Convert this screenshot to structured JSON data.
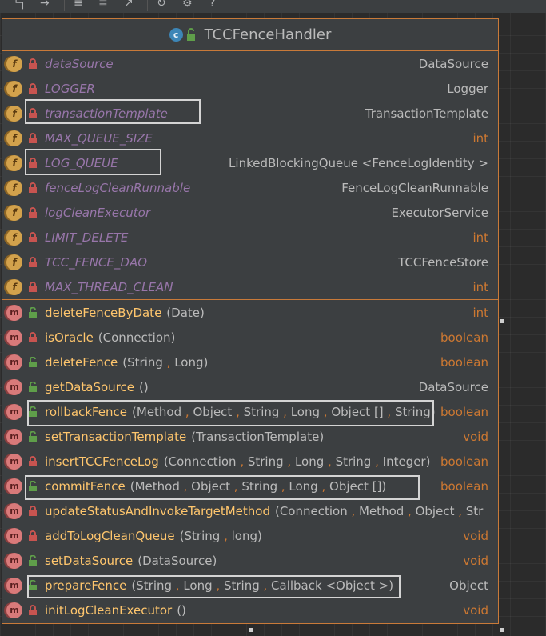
{
  "toolbar": {
    "icons": [
      "layout-icon",
      "arrow-icon",
      "list-icon",
      "filter-icon",
      "export-icon",
      "refresh-icon",
      "gear-icon",
      "help-icon"
    ],
    "help_label": "?"
  },
  "node": {
    "class_badge": "c",
    "title": "TCCFenceHandler",
    "fields": [
      {
        "name": "dataSource",
        "type": "DataSource",
        "keyword": false
      },
      {
        "name": "LOGGER",
        "type": "Logger",
        "keyword": false
      },
      {
        "name": "transactionTemplate",
        "type": "TransactionTemplate",
        "keyword": false
      },
      {
        "name": "MAX_QUEUE_SIZE",
        "type": "int",
        "keyword": true
      },
      {
        "name": "LOG_QUEUE",
        "type": "LinkedBlockingQueue <FenceLogIdentity >",
        "keyword": false
      },
      {
        "name": "fenceLogCleanRunnable",
        "type": "FenceLogCleanRunnable",
        "keyword": false
      },
      {
        "name": "logCleanExecutor",
        "type": "ExecutorService",
        "keyword": false
      },
      {
        "name": "LIMIT_DELETE",
        "type": "int",
        "keyword": true
      },
      {
        "name": "TCC_FENCE_DAO",
        "type": "TCCFenceStore",
        "keyword": false
      },
      {
        "name": "MAX_THREAD_CLEAN",
        "type": "int",
        "keyword": true
      }
    ],
    "methods": [
      {
        "name": "deleteFenceByDate",
        "params": [
          "Date"
        ],
        "return": "int",
        "keyword": true,
        "public": true
      },
      {
        "name": "isOracle",
        "params": [
          "Connection"
        ],
        "return": "boolean",
        "keyword": true,
        "public": false
      },
      {
        "name": "deleteFence",
        "params": [
          "String",
          "Long"
        ],
        "return": "boolean",
        "keyword": true,
        "public": true
      },
      {
        "name": "getDataSource",
        "params": [],
        "return": "DataSource",
        "keyword": false,
        "public": true
      },
      {
        "name": "rollbackFence",
        "params": [
          "Method",
          "Object",
          "String",
          "Long",
          "Object []",
          "String"
        ],
        "return": "boolean",
        "keyword": true,
        "public": true
      },
      {
        "name": "setTransactionTemplate",
        "params": [
          "TransactionTemplate"
        ],
        "return": "void",
        "keyword": true,
        "public": true
      },
      {
        "name": "insertTCCFenceLog",
        "params": [
          "Connection",
          "String",
          "Long",
          "String",
          "Integer"
        ],
        "return": "boolean",
        "keyword": true,
        "public": false
      },
      {
        "name": "commitFence",
        "params": [
          "Method",
          "Object",
          "String",
          "Long",
          "Object []"
        ],
        "return": "boolean",
        "keyword": true,
        "public": true
      },
      {
        "name": "updateStatusAndInvokeTargetMethod",
        "params": [
          "Connection",
          "Method",
          "Object",
          "Str"
        ],
        "return": "",
        "keyword": false,
        "public": false
      },
      {
        "name": "addToLogCleanQueue",
        "params": [
          "String",
          "long"
        ],
        "return": "void",
        "keyword": true,
        "public": false
      },
      {
        "name": "setDataSource",
        "params": [
          "DataSource"
        ],
        "return": "void",
        "keyword": true,
        "public": true
      },
      {
        "name": "prepareFence",
        "params": [
          "String",
          "Long",
          "String",
          "Callback <Object >"
        ],
        "return": "Object",
        "keyword": false,
        "public": true
      },
      {
        "name": "initLogCleanExecutor",
        "params": [],
        "return": "void",
        "keyword": true,
        "public": false
      }
    ]
  },
  "colors": {
    "background": "#2b2b2b",
    "node_border": "#c97a39",
    "field_name": "#9876aa",
    "method_name": "#ffc66d",
    "keyword": "#cc7832",
    "plain_text": "#bbbbbb",
    "highlight_box": "#d4d4d4"
  }
}
